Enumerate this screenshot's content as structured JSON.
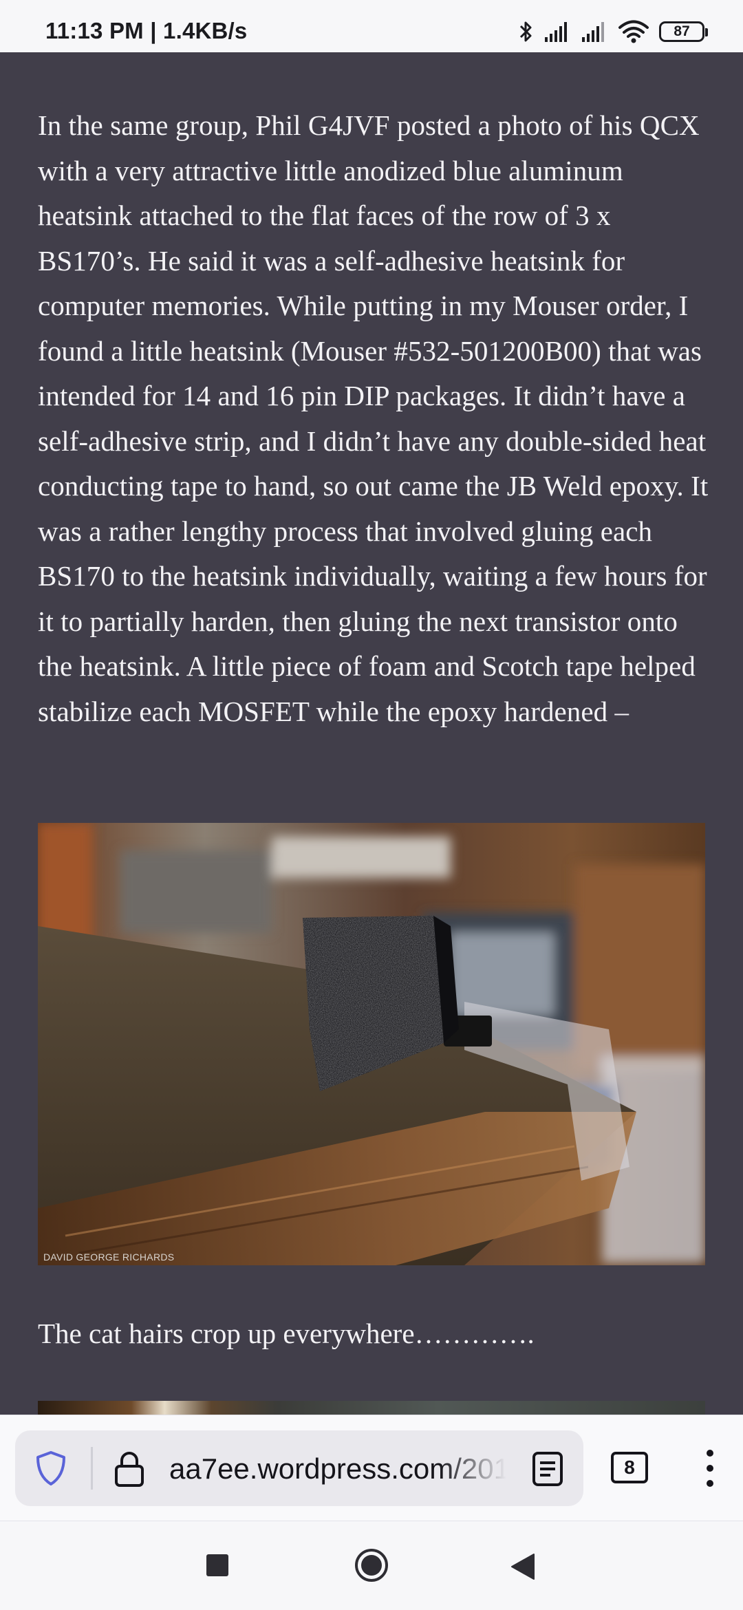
{
  "status_bar": {
    "time": "11:13 PM | 1.4KB/s",
    "battery": "87",
    "icons": [
      "bluetooth-icon",
      "signal-icon",
      "signal-icon",
      "wifi-icon",
      "battery-icon"
    ]
  },
  "article": {
    "paragraph": "In the same group, Phil G4JVF posted a photo of his QCX with a very attractive little anodized blue aluminum heatsink attached to the flat faces of the row of 3 x BS170’s. He said it was a self-adhesive heatsink for computer memories. While putting in my Mouser order, I found a little heatsink (Mouser #532-501200B00) that was intended for 14 and 16 pin DIP packages. It didn’t have a self-adhesive strip, and I didn’t have any double-sided heat conducting tape to hand, so out came the JB Weld epoxy. It was a rather lengthy process that involved gluing each BS170 to the heatsink individually, waiting a few hours for it to partially harden, then gluing the next transistor onto the heatsink. A little piece of foam and Scotch tape helped stabilize each MOSFET while the epoxy hardened –",
    "photo_credit": "DAVID GEORGE RICHARDS",
    "caption": "The cat hairs crop up everywhere…………."
  },
  "toolbar": {
    "url": "aa7ee.wordpress.com/201",
    "tab_count": "8",
    "icons": [
      "shield-icon",
      "lock-icon",
      "reader-view-icon",
      "tabs-icon",
      "more-menu-icon"
    ]
  },
  "nav_bar": {
    "icons": [
      "recents-icon",
      "home-icon",
      "back-icon"
    ]
  },
  "colors": {
    "page_background": "#413e4a",
    "text": "#f3f2f5",
    "shield_accent": "#5a63d8"
  }
}
